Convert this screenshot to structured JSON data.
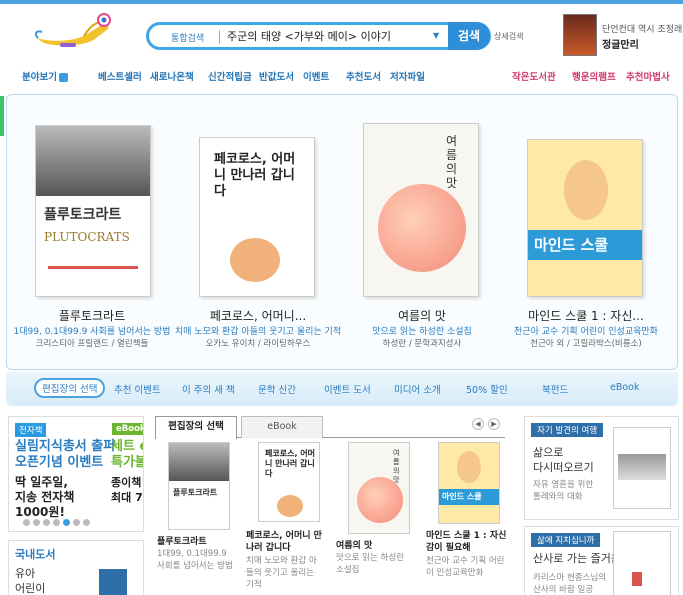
{
  "header": {
    "search_scope": "통합검색",
    "search_query": "주군의 태양 <가부와 메이> 이야기",
    "search_button": "검색",
    "detail_search": "상세검색",
    "ad_line1": "단언컨대 역시 조정래",
    "ad_line2": "정글만리"
  },
  "nav": {
    "category": "분야보기",
    "items": [
      "베스트셀러",
      "새로나온책",
      "신간적립금",
      "반값도서",
      "이벤트",
      "추천도서",
      "저자파일"
    ],
    "right_items": [
      "작은도서관",
      "행운의램프",
      "추천마법사"
    ]
  },
  "featured": {
    "books": [
      {
        "title": "플루토크라트",
        "desc": "1대99, 0.1대99.9 사회를 넘어서는 방법",
        "author": "크리스티아 프릴랜드 / 열린책들",
        "cover_title": "플루토크라트",
        "cover_sub": "PLUTOCRATS"
      },
      {
        "title": "페코로스, 어머니...",
        "desc": "치매 노모와 환갑 아들의 웃기고 울리는 기적",
        "author": "오카노 유이치 / 라이팅하우스",
        "cover_title": "페코로스, 어머니 만나러 갑니다"
      },
      {
        "title": "여름의 맛",
        "desc": "맛으로 읽는 하성란 소설집",
        "author": "하성란 / 문학과지성사",
        "cover_title": "여름의 맛"
      },
      {
        "title": "마인드 스쿨 1 : 자신...",
        "desc": "천근아 교수 기획 어린이 인성교육만화",
        "author": "천근아 외 / 고릴라박스(비룡소)",
        "cover_title": "마인드 스쿨"
      }
    ],
    "tabs": [
      "편집장의 선택",
      "추천 이벤트",
      "이 주의 새 책",
      "문학 신간",
      "이벤트 도서",
      "미디어 소개",
      "50% 할인",
      "북펀드",
      "eBook"
    ]
  },
  "ebook_promo": {
    "badge": "전자책",
    "badge2": "eBook",
    "line1": "실림지식총서 출퍼",
    "line2": "오픈기념 이벤트",
    "line3": "딱 일주일,",
    "line4": "지송 전자책",
    "line5": "1000원!",
    "side1": "세트 e",
    "side2": "특가볼",
    "side3": "종이책",
    "side4": "최대 75"
  },
  "domestic": {
    "title": "국내도서",
    "item1": "유아",
    "item2": "어린이"
  },
  "lower_tabs": {
    "tabs": [
      "편집장의 선택",
      "eBook"
    ],
    "books": [
      {
        "title": "플루토크라트",
        "desc": "1대99, 0.1대99.9 사회를 넘어서는 방법"
      },
      {
        "title": "페코로스, 어머니 만나러 갑니다",
        "desc": "치매 노모와 환갑 아들의 웃기고 울리는 기적"
      },
      {
        "title": "여름의 맛",
        "desc": "맛으로 읽는 하성란 소설집"
      },
      {
        "title": "마인드 스쿨 1 : 자신감이 필요해",
        "desc": "천근아 교수 기획 어린이 인성교육만화"
      }
    ]
  },
  "right_panel": {
    "box1_head": "자기 발견의 여행",
    "box1_title1": "삶으로",
    "box1_title2": "다시떠오르기",
    "box1_desc1": "자유 영혼을 위한",
    "box1_desc2": "톨레와의 대화",
    "box2_head": "삶에 지치십니까",
    "box2_title": "산사로 가는 즐거움",
    "box2_desc1": "카리스마 현종스님의",
    "box2_desc2": "산사의 바람 일공"
  }
}
